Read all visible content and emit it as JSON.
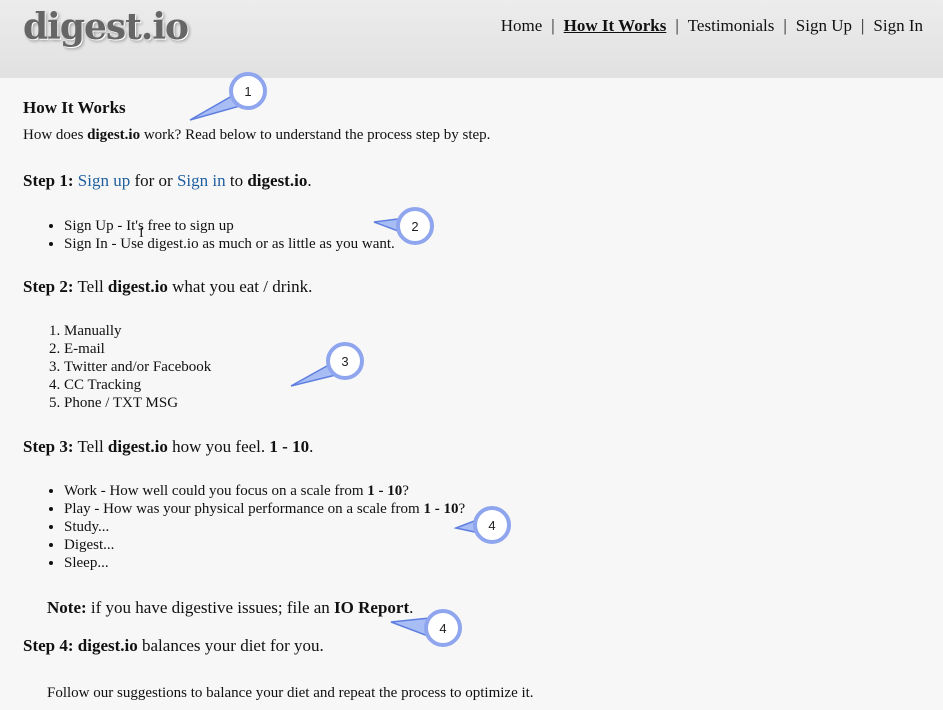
{
  "header": {
    "logo": "digest.io",
    "nav": [
      {
        "label": "Home",
        "active": false
      },
      {
        "label": "How It Works",
        "active": true
      },
      {
        "label": "Testimonials",
        "active": false
      },
      {
        "label": "Sign Up",
        "active": false
      },
      {
        "label": "Sign In",
        "active": false
      }
    ],
    "separator": "|"
  },
  "main": {
    "title": "How It Works",
    "intro": {
      "pre": "How does ",
      "brand": "digest.io",
      "post": " work?  Read below to understand the process step by step."
    },
    "step1": {
      "label": "Step 1:",
      "link1": "Sign up",
      "mid": " for or ",
      "link2": "Sign in",
      "pre_brand": " to ",
      "brand": "digest.io",
      "end": "."
    },
    "step1_items": [
      "Sign Up - It's free to sign up",
      "Sign In - Use digest.io as much or as little as you want."
    ],
    "step2": {
      "label": "Step 2:",
      "pre": " Tell ",
      "brand": "digest.io",
      "post": " what you eat / drink."
    },
    "step2_items": [
      "Manually",
      "E-mail",
      "Twitter and/or Facebook",
      "CC Tracking",
      "Phone / TXT MSG"
    ],
    "step3": {
      "label": "Step 3:",
      "pre": " Tell ",
      "brand": "digest.io",
      "post": " how you feel. ",
      "scale": "1 - 10",
      "end": "."
    },
    "step3_items": [
      {
        "pre": "Work - How well could you focus on a scale from ",
        "bold": "1 - 10",
        "post": "?"
      },
      {
        "pre": "Play - How was your physical performance on a scale from ",
        "bold": "1 - 10",
        "post": "?"
      },
      {
        "pre": "Study...",
        "bold": "",
        "post": ""
      },
      {
        "pre": "Digest...",
        "bold": "",
        "post": ""
      },
      {
        "pre": "Sleep...",
        "bold": "",
        "post": ""
      }
    ],
    "note": {
      "label": "Note:",
      "text": " if you have digestive issues; file an ",
      "bold": "IO Report",
      "end": "."
    },
    "step4": {
      "label": "Step 4:",
      "brand": " digest.io",
      "post": " balances your diet for you."
    },
    "follow": "Follow our suggestions to balance your diet and repeat the process to optimize it."
  },
  "callouts": [
    "1",
    "2",
    "3",
    "4",
    "4"
  ],
  "colors": {
    "callout_fill": "#a9bdf5",
    "callout_stroke": "#5f7fe0",
    "link": "#1f5fa0"
  }
}
